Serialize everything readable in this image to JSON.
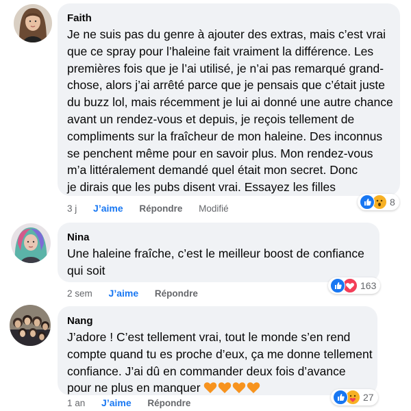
{
  "comments": [
    {
      "author": "Faith",
      "lines": [
        "Je ne suis pas du genre à ajouter des extras, mais c’est vrai",
        "que ce spray pour l’haleine fait vraiment la différence. Les",
        "premières fois que je l’ai utilisé, je n’ai pas remarqué grand-",
        "chose, alors j’ai arrêté parce que je pensais que c’était juste",
        "du buzz lol, mais récemment je lui ai donné une autre chance",
        "avant un rendez-vous et depuis, je reçois tellement de",
        "compliments sur la fraîcheur de mon haleine. Des inconnus",
        "se penchent même pour en savoir plus. Mon rendez-vous",
        "m’a littéralement demandé quel était mon secret. Donc",
        "je dirais que les pubs disent vrai. Essayez les filles"
      ],
      "time": "3 j",
      "like": "J’aime",
      "reply": "Répondre",
      "edited": "Modifié",
      "reaction_icons": [
        "like-icon",
        "wow-icon"
      ],
      "reaction_count": "8"
    },
    {
      "author": "Nina",
      "lines": [
        "Une haleine fraîche, c’est le meilleur boost de confiance",
        "qui soit"
      ],
      "time": "2 sem",
      "like": "J’aime",
      "reply": "Répondre",
      "reaction_icons": [
        "like-icon",
        "love-icon"
      ],
      "reaction_count": "163"
    },
    {
      "author": "Nang",
      "lines": [
        "J’adore ! C’est tellement vrai, tout le monde s’en rend",
        "compte quand tu es proche d’eux, ça me donne tellement",
        "confiance. J’ai dû en commander deux fois d’avance",
        "pour ne plus en manquer"
      ],
      "trailing_icons": [
        "orange-heart-icon",
        "orange-heart-icon",
        "orange-heart-icon",
        "orange-heart-icon"
      ],
      "time": "1 an",
      "like": "J’aime",
      "reply": "Répondre",
      "reaction_icons": [
        "like-icon",
        "care-icon"
      ],
      "reaction_count": "27"
    }
  ],
  "colors": {
    "bubble": "#f0f2f5",
    "like_blue": "#1877f2",
    "meta_gray": "#65676b",
    "love_red": "#f33e58",
    "heart_orange": "#f7931e"
  }
}
